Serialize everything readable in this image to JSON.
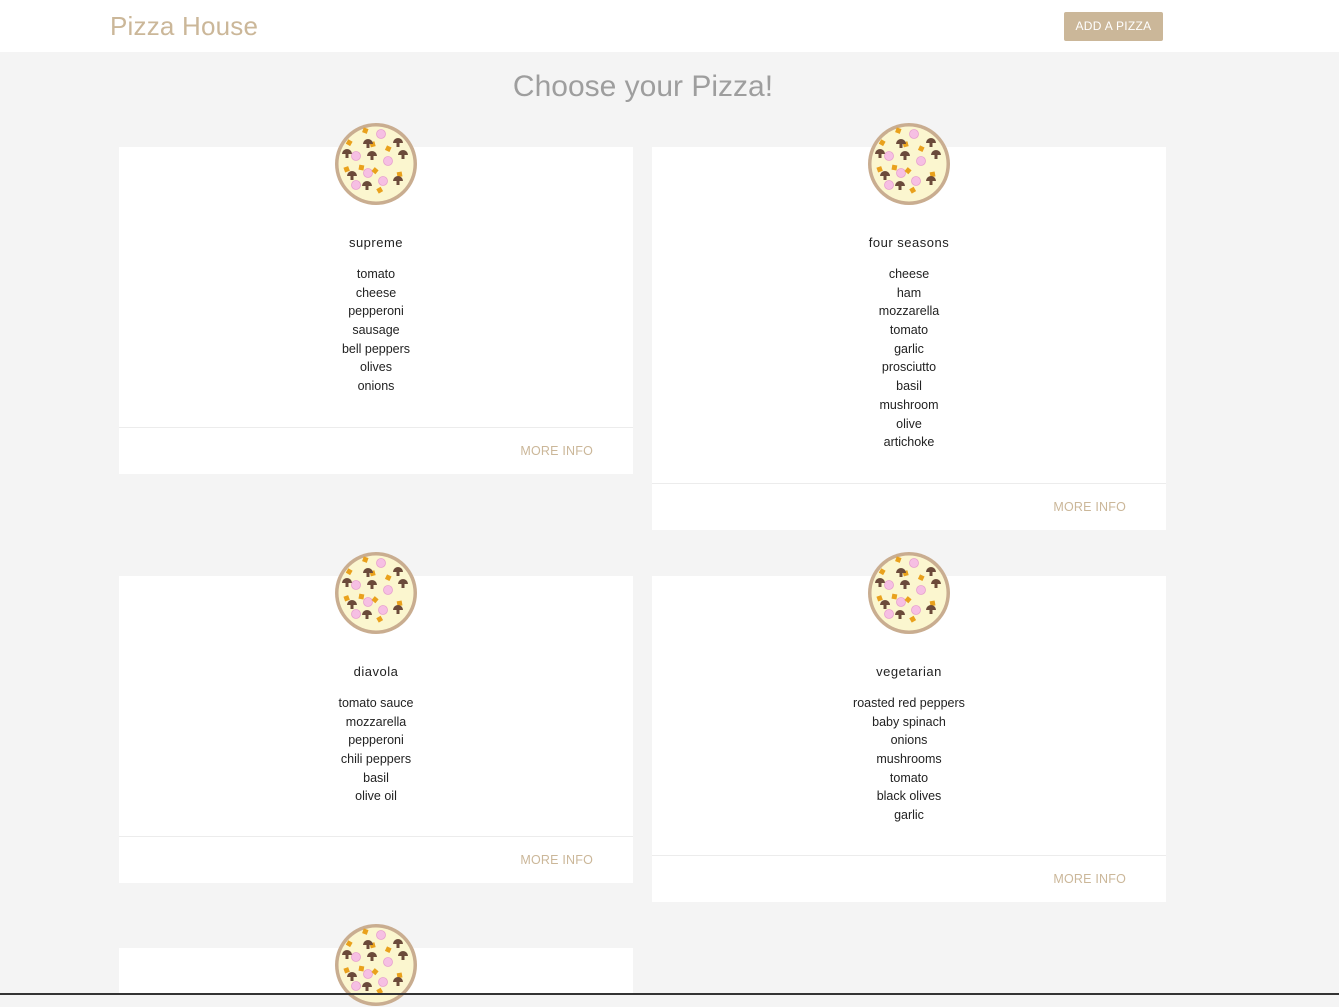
{
  "nav": {
    "brand": "Pizza House",
    "add_button": "ADD A PIZZA"
  },
  "heading": "Choose your Pizza!",
  "pizzas": [
    {
      "name": "supreme",
      "ingredients": [
        "tomato",
        "cheese",
        "pepperoni",
        "sausage",
        "bell peppers",
        "olives",
        "onions"
      ],
      "action": "MORE INFO"
    },
    {
      "name": "four seasons",
      "ingredients": [
        "cheese",
        "ham",
        "mozzarella",
        "tomato",
        "garlic",
        "prosciutto",
        "basil",
        "mushroom",
        "olive",
        "artichoke"
      ],
      "action": "MORE INFO"
    },
    {
      "name": "diavola",
      "ingredients": [
        "tomato sauce",
        "mozzarella",
        "pepperoni",
        "chili peppers",
        "basil",
        "olive oil"
      ],
      "action": "MORE INFO"
    },
    {
      "name": "vegetarian",
      "ingredients": [
        "roasted red peppers",
        "baby spinach",
        "onions",
        "mushrooms",
        "tomato",
        "black olives",
        "garlic"
      ],
      "action": "MORE INFO"
    },
    {
      "name": "",
      "ingredients": [],
      "action": ""
    }
  ],
  "colors": {
    "accent": "#cbb799",
    "background": "#f4f4f4",
    "card": "#ffffff"
  }
}
